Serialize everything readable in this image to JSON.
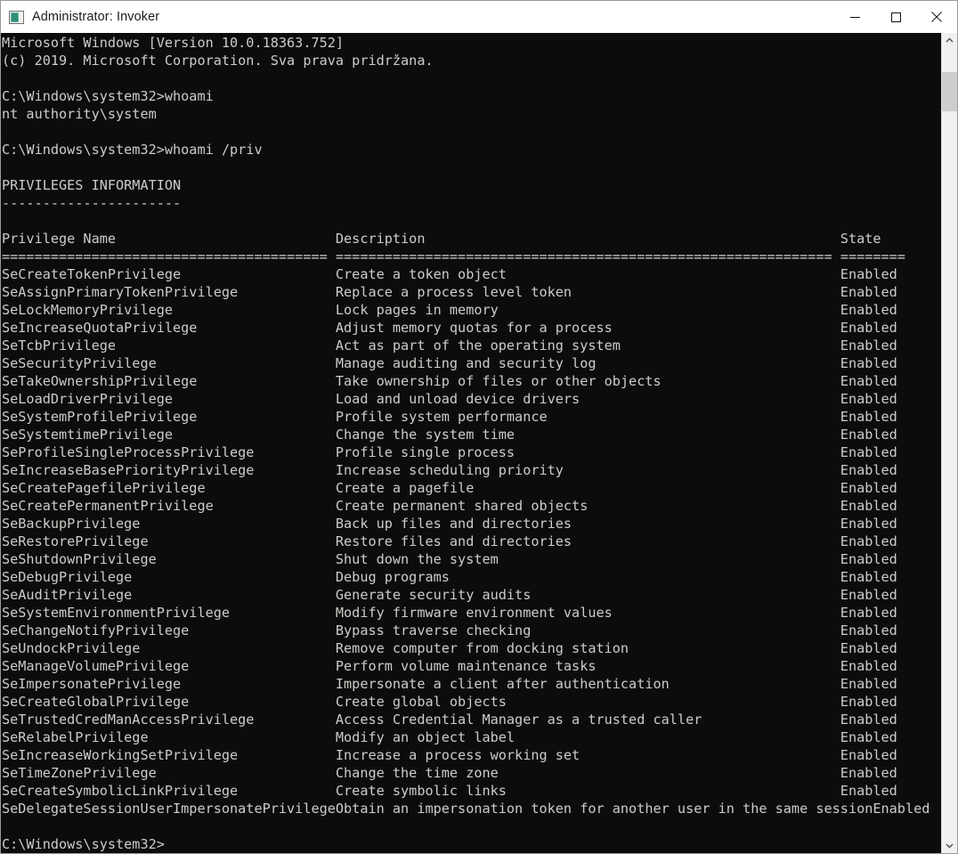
{
  "window": {
    "title": "Administrator: Invoker",
    "icon": "console-window-icon",
    "colors": {
      "titlebar_bg": "#ffffff",
      "title_text": "#1b1b1b",
      "console_bg": "#0c0c0c",
      "console_text": "#ccccc8",
      "scrollbar_track": "#f0f0f0",
      "scrollbar_thumb": "#cdcdcd"
    },
    "controls": [
      {
        "name": "minimize-button",
        "glyph": "minimize-icon",
        "label": "Minimize"
      },
      {
        "name": "maximize-button",
        "glyph": "maximize-icon",
        "label": "Maximize"
      },
      {
        "name": "close-button",
        "glyph": "close-icon",
        "label": "Close"
      }
    ]
  },
  "scrollbar": {
    "up_arrow": "chevron-up-icon",
    "down_arrow": "chevron-down-icon",
    "thumb_top_pct": 3,
    "thumb_height_pct": 5
  },
  "console": {
    "banner": [
      "Microsoft Windows [Version 10.0.18363.752]",
      "(c) 2019. Microsoft Corporation. Sva prava pridržana."
    ],
    "prompt": "C:\\Windows\\system32>",
    "commands": [
      {
        "cmd": "whoami",
        "output": [
          "nt authority\\system"
        ]
      },
      {
        "cmd": "whoami /priv",
        "output": []
      }
    ],
    "priv_section_title": "PRIVILEGES INFORMATION",
    "priv_section_underline": "----------------------",
    "columns": {
      "headers": [
        "Privilege Name",
        "Description",
        "State"
      ],
      "separators": [
        "=============================================",
        "==============================================================================",
        "========"
      ],
      "name_col_width": 41,
      "desc_col_width": 62
    },
    "privileges": [
      {
        "name": "SeCreateTokenPrivilege",
        "description": "Create a token object",
        "state": "Enabled"
      },
      {
        "name": "SeAssignPrimaryTokenPrivilege",
        "description": "Replace a process level token",
        "state": "Enabled"
      },
      {
        "name": "SeLockMemoryPrivilege",
        "description": "Lock pages in memory",
        "state": "Enabled"
      },
      {
        "name": "SeIncreaseQuotaPrivilege",
        "description": "Adjust memory quotas for a process",
        "state": "Enabled"
      },
      {
        "name": "SeTcbPrivilege",
        "description": "Act as part of the operating system",
        "state": "Enabled"
      },
      {
        "name": "SeSecurityPrivilege",
        "description": "Manage auditing and security log",
        "state": "Enabled"
      },
      {
        "name": "SeTakeOwnershipPrivilege",
        "description": "Take ownership of files or other objects",
        "state": "Enabled"
      },
      {
        "name": "SeLoadDriverPrivilege",
        "description": "Load and unload device drivers",
        "state": "Enabled"
      },
      {
        "name": "SeSystemProfilePrivilege",
        "description": "Profile system performance",
        "state": "Enabled"
      },
      {
        "name": "SeSystemtimePrivilege",
        "description": "Change the system time",
        "state": "Enabled"
      },
      {
        "name": "SeProfileSingleProcessPrivilege",
        "description": "Profile single process",
        "state": "Enabled"
      },
      {
        "name": "SeIncreaseBasePriorityPrivilege",
        "description": "Increase scheduling priority",
        "state": "Enabled"
      },
      {
        "name": "SeCreatePagefilePrivilege",
        "description": "Create a pagefile",
        "state": "Enabled"
      },
      {
        "name": "SeCreatePermanentPrivilege",
        "description": "Create permanent shared objects",
        "state": "Enabled"
      },
      {
        "name": "SeBackupPrivilege",
        "description": "Back up files and directories",
        "state": "Enabled"
      },
      {
        "name": "SeRestorePrivilege",
        "description": "Restore files and directories",
        "state": "Enabled"
      },
      {
        "name": "SeShutdownPrivilege",
        "description": "Shut down the system",
        "state": "Enabled"
      },
      {
        "name": "SeDebugPrivilege",
        "description": "Debug programs",
        "state": "Enabled"
      },
      {
        "name": "SeAuditPrivilege",
        "description": "Generate security audits",
        "state": "Enabled"
      },
      {
        "name": "SeSystemEnvironmentPrivilege",
        "description": "Modify firmware environment values",
        "state": "Enabled"
      },
      {
        "name": "SeChangeNotifyPrivilege",
        "description": "Bypass traverse checking",
        "state": "Enabled"
      },
      {
        "name": "SeUndockPrivilege",
        "description": "Remove computer from docking station",
        "state": "Enabled"
      },
      {
        "name": "SeManageVolumePrivilege",
        "description": "Perform volume maintenance tasks",
        "state": "Enabled"
      },
      {
        "name": "SeImpersonatePrivilege",
        "description": "Impersonate a client after authentication",
        "state": "Enabled"
      },
      {
        "name": "SeCreateGlobalPrivilege",
        "description": "Create global objects",
        "state": "Enabled"
      },
      {
        "name": "SeTrustedCredManAccessPrivilege",
        "description": "Access Credential Manager as a trusted caller",
        "state": "Enabled"
      },
      {
        "name": "SeRelabelPrivilege",
        "description": "Modify an object label",
        "state": "Enabled"
      },
      {
        "name": "SeIncreaseWorkingSetPrivilege",
        "description": "Increase a process working set",
        "state": "Enabled"
      },
      {
        "name": "SeTimeZonePrivilege",
        "description": "Change the time zone",
        "state": "Enabled"
      },
      {
        "name": "SeCreateSymbolicLinkPrivilege",
        "description": "Create symbolic links",
        "state": "Enabled"
      },
      {
        "name": "SeDelegateSessionUserImpersonatePrivilege",
        "description": "Obtain an impersonation token for another user in the same session",
        "state": "Enabled"
      }
    ]
  }
}
